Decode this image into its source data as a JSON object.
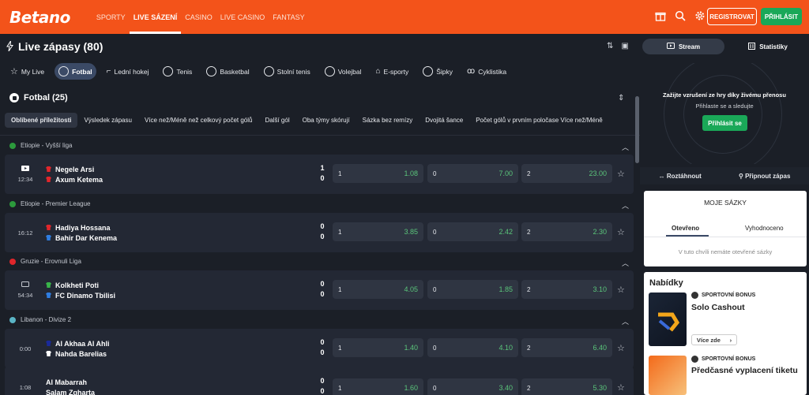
{
  "header": {
    "logo": "Betano",
    "nav": [
      "SPORTY",
      "LIVE SÁZENÍ",
      "CASINO",
      "LIVE CASINO",
      "FANTASY"
    ],
    "register": "REGISTROVAT",
    "login": "PŘIHLÁSIT"
  },
  "page": {
    "title": "Live zápasy (80)"
  },
  "sports": [
    "My Live",
    "Fotbal",
    "Lední hokej",
    "Tenis",
    "Basketbal",
    "Stolní tenis",
    "Volejbal",
    "E-sporty",
    "Šipky",
    "Cyklistika"
  ],
  "section": {
    "title": "Fotbal (25)"
  },
  "market_tabs": [
    "Oblíbené příležitosti",
    "Výsledek zápasu",
    "Více než/Méně než celkový počet gólů",
    "Další gól",
    "Oba týmy skórují",
    "Sázka bez remízy",
    "Dvojitá šance",
    "Počet gólů v prvním poločase Více než/Méně"
  ],
  "leagues": [
    {
      "name": "Etiopie - Vyšší liga",
      "flag": "#2c9a3c",
      "match": {
        "time": "12:34",
        "home": "Negele Arsi",
        "away": "Axum Ketema",
        "hs": "1",
        "as": "0",
        "home_color": "#e0262b",
        "away_color": "#e0262b",
        "odds": [
          {
            "l": "1",
            "v": "1.08"
          },
          {
            "l": "0",
            "v": "7.00"
          },
          {
            "l": "2",
            "v": "23.00"
          }
        ]
      }
    },
    {
      "name": "Etiopie - Premier League",
      "flag": "#2c9a3c",
      "match": {
        "time": "16:12",
        "home": "Hadiya Hossana",
        "away": "Bahir Dar Kenema",
        "hs": "0",
        "as": "0",
        "home_color": "#e0262b",
        "away_color": "#2f7de1",
        "odds": [
          {
            "l": "1",
            "v": "3.85"
          },
          {
            "l": "0",
            "v": "2.42"
          },
          {
            "l": "2",
            "v": "2.30"
          }
        ]
      }
    },
    {
      "name": "Gruzie - Erovnuli Liga",
      "flag": "#e0262b",
      "match": {
        "time": "54:34",
        "home": "Kolkheti Poti",
        "away": "FC Dinamo Tbilisi",
        "hs": "0",
        "as": "0",
        "home_color": "#39b54a",
        "away_color": "#2f7de1",
        "odds": [
          {
            "l": "1",
            "v": "4.05"
          },
          {
            "l": "0",
            "v": "1.85"
          },
          {
            "l": "2",
            "v": "3.10"
          }
        ]
      }
    },
    {
      "name": "Libanon - Divize 2",
      "flag": "#5ab4c5",
      "match": {
        "time": "0:00",
        "home": "Al Akhaa Al Ahli",
        "away": "Nahda Barelias",
        "hs": "0",
        "as": "0",
        "home_color": "#1a2a9a",
        "away_color": "#ffffff",
        "odds": [
          {
            "l": "1",
            "v": "1.40"
          },
          {
            "l": "0",
            "v": "4.10"
          },
          {
            "l": "2",
            "v": "6.40"
          }
        ]
      }
    },
    {
      "name": "",
      "flag": "",
      "match": {
        "time": "1:08",
        "home": "Al Mabarrah",
        "away": "Salam Zgharta",
        "hs": "0",
        "as": "0",
        "home_color": "",
        "away_color": "",
        "odds": [
          {
            "l": "1",
            "v": "1.60"
          },
          {
            "l": "0",
            "v": "3.40"
          },
          {
            "l": "2",
            "v": "5.30"
          }
        ]
      }
    }
  ],
  "sidebar": {
    "stream_tab": "Stream",
    "stats_tab": "Statistiky",
    "stream_msg": "Zažijte vzrušení ze hry díky živému přenosu",
    "stream_sub": "Přihlaste se a sledujte",
    "stream_login": "Přihlásit se",
    "expand": "Roztáhnout",
    "pin": "Připnout zápas"
  },
  "bets": {
    "title": "MOJE SÁZKY",
    "tab_open": "Otevřeno",
    "tab_settled": "Vyhodnoceno",
    "empty": "V tuto chvíli nemáte otevřené sázky"
  },
  "offers": {
    "title": "Nabídky",
    "items": [
      {
        "tag": "SPORTOVNÍ BONUS",
        "name": "Solo Cashout",
        "more": "Více zde"
      },
      {
        "tag": "SPORTOVNÍ BONUS",
        "name": "Předčasné vyplacení tiketu"
      }
    ]
  },
  "colors": {
    "brand": "#f3531a",
    "green": "#1aa858",
    "odd_value": "#5ac47a"
  }
}
